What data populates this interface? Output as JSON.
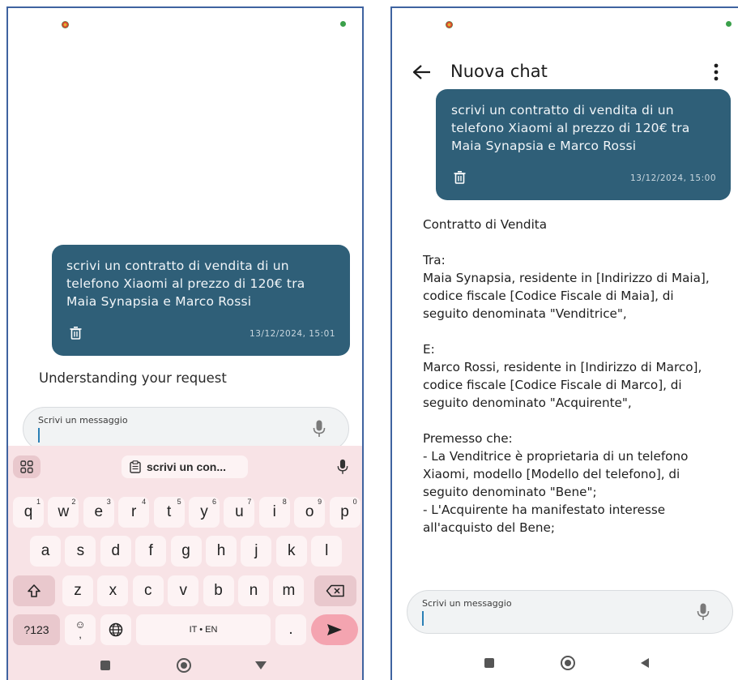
{
  "left_screen": {
    "message": {
      "text": "scrivi un contratto di vendita di un telefono Xiaomi al prezzo di 120€ tra Maia Synapsia e Marco Rossi",
      "time": "13/12/2024, 15:01"
    },
    "status_text": "Understanding your request",
    "input": {
      "placeholder": "Scrivi un messaggio"
    },
    "keyboard": {
      "clipboard_suggestion": "scrivi un con...",
      "row1": [
        {
          "key": "q",
          "sup": "1"
        },
        {
          "key": "w",
          "sup": "2"
        },
        {
          "key": "e",
          "sup": "3"
        },
        {
          "key": "r",
          "sup": "4"
        },
        {
          "key": "t",
          "sup": "5"
        },
        {
          "key": "y",
          "sup": "6"
        },
        {
          "key": "u",
          "sup": "7"
        },
        {
          "key": "i",
          "sup": "8"
        },
        {
          "key": "o",
          "sup": "9"
        },
        {
          "key": "p",
          "sup": "0"
        }
      ],
      "row2": [
        "a",
        "s",
        "d",
        "f",
        "g",
        "h",
        "j",
        "k",
        "l"
      ],
      "row3": [
        "z",
        "x",
        "c",
        "v",
        "b",
        "n",
        "m"
      ],
      "symbols_key": "?123",
      "space_label": "IT • EN",
      "period_key": ".",
      "emoji_key_top": "☺",
      "emoji_key_bottom": ","
    }
  },
  "right_screen": {
    "header": {
      "title": "Nuova chat"
    },
    "message": {
      "text": "scrivi un contratto di vendita di un telefono Xiaomi al prezzo di 120€ tra Maia Synapsia e Marco Rossi",
      "time": "13/12/2024, 15:00"
    },
    "response": {
      "title": "Contratto di Vendita",
      "tra_label": "Tra:",
      "tra_body": "Maia Synapsia, residente in [Indirizzo di Maia], codice fiscale [Codice Fiscale di Maia], di seguito denominata \"Venditrice\",",
      "e_label": "E:",
      "e_body": "Marco Rossi, residente in [Indirizzo di Marco], codice fiscale [Codice Fiscale di Marco], di seguito denominato \"Acquirente\",",
      "premesso_label": "Premesso che:",
      "premesso_1": "- La Venditrice è proprietaria di un telefono Xiaomi, modello [Modello del telefono], di seguito denominato \"Bene\";",
      "premesso_2": "- L'Acquirente ha manifestato interesse all'acquisto del Bene;"
    },
    "input": {
      "placeholder": "Scrivi un messaggio"
    }
  },
  "colors": {
    "bubble": "#2f5f78",
    "keyboard_bg": "#f8e3e6",
    "send_button": "#f4a4b0",
    "frame": "#3f63a0"
  }
}
